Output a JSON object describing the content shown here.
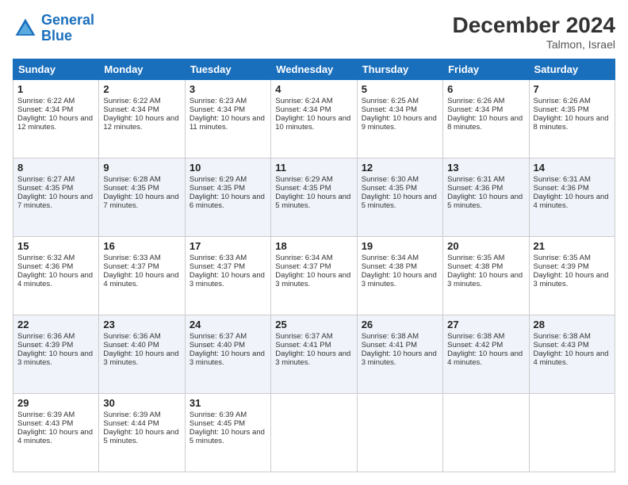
{
  "header": {
    "logo_line1": "General",
    "logo_line2": "Blue",
    "month_title": "December 2024",
    "location": "Talmon, Israel"
  },
  "days_of_week": [
    "Sunday",
    "Monday",
    "Tuesday",
    "Wednesday",
    "Thursday",
    "Friday",
    "Saturday"
  ],
  "weeks": [
    [
      {
        "day": "1",
        "sunrise": "6:22 AM",
        "sunset": "4:34 PM",
        "daylight": "10 hours and 12 minutes."
      },
      {
        "day": "2",
        "sunrise": "6:22 AM",
        "sunset": "4:34 PM",
        "daylight": "10 hours and 12 minutes."
      },
      {
        "day": "3",
        "sunrise": "6:23 AM",
        "sunset": "4:34 PM",
        "daylight": "10 hours and 11 minutes."
      },
      {
        "day": "4",
        "sunrise": "6:24 AM",
        "sunset": "4:34 PM",
        "daylight": "10 hours and 10 minutes."
      },
      {
        "day": "5",
        "sunrise": "6:25 AM",
        "sunset": "4:34 PM",
        "daylight": "10 hours and 9 minutes."
      },
      {
        "day": "6",
        "sunrise": "6:26 AM",
        "sunset": "4:34 PM",
        "daylight": "10 hours and 8 minutes."
      },
      {
        "day": "7",
        "sunrise": "6:26 AM",
        "sunset": "4:35 PM",
        "daylight": "10 hours and 8 minutes."
      }
    ],
    [
      {
        "day": "8",
        "sunrise": "6:27 AM",
        "sunset": "4:35 PM",
        "daylight": "10 hours and 7 minutes."
      },
      {
        "day": "9",
        "sunrise": "6:28 AM",
        "sunset": "4:35 PM",
        "daylight": "10 hours and 7 minutes."
      },
      {
        "day": "10",
        "sunrise": "6:29 AM",
        "sunset": "4:35 PM",
        "daylight": "10 hours and 6 minutes."
      },
      {
        "day": "11",
        "sunrise": "6:29 AM",
        "sunset": "4:35 PM",
        "daylight": "10 hours and 5 minutes."
      },
      {
        "day": "12",
        "sunrise": "6:30 AM",
        "sunset": "4:35 PM",
        "daylight": "10 hours and 5 minutes."
      },
      {
        "day": "13",
        "sunrise": "6:31 AM",
        "sunset": "4:36 PM",
        "daylight": "10 hours and 5 minutes."
      },
      {
        "day": "14",
        "sunrise": "6:31 AM",
        "sunset": "4:36 PM",
        "daylight": "10 hours and 4 minutes."
      }
    ],
    [
      {
        "day": "15",
        "sunrise": "6:32 AM",
        "sunset": "4:36 PM",
        "daylight": "10 hours and 4 minutes."
      },
      {
        "day": "16",
        "sunrise": "6:33 AM",
        "sunset": "4:37 PM",
        "daylight": "10 hours and 4 minutes."
      },
      {
        "day": "17",
        "sunrise": "6:33 AM",
        "sunset": "4:37 PM",
        "daylight": "10 hours and 3 minutes."
      },
      {
        "day": "18",
        "sunrise": "6:34 AM",
        "sunset": "4:37 PM",
        "daylight": "10 hours and 3 minutes."
      },
      {
        "day": "19",
        "sunrise": "6:34 AM",
        "sunset": "4:38 PM",
        "daylight": "10 hours and 3 minutes."
      },
      {
        "day": "20",
        "sunrise": "6:35 AM",
        "sunset": "4:38 PM",
        "daylight": "10 hours and 3 minutes."
      },
      {
        "day": "21",
        "sunrise": "6:35 AM",
        "sunset": "4:39 PM",
        "daylight": "10 hours and 3 minutes."
      }
    ],
    [
      {
        "day": "22",
        "sunrise": "6:36 AM",
        "sunset": "4:39 PM",
        "daylight": "10 hours and 3 minutes."
      },
      {
        "day": "23",
        "sunrise": "6:36 AM",
        "sunset": "4:40 PM",
        "daylight": "10 hours and 3 minutes."
      },
      {
        "day": "24",
        "sunrise": "6:37 AM",
        "sunset": "4:40 PM",
        "daylight": "10 hours and 3 minutes."
      },
      {
        "day": "25",
        "sunrise": "6:37 AM",
        "sunset": "4:41 PM",
        "daylight": "10 hours and 3 minutes."
      },
      {
        "day": "26",
        "sunrise": "6:38 AM",
        "sunset": "4:41 PM",
        "daylight": "10 hours and 3 minutes."
      },
      {
        "day": "27",
        "sunrise": "6:38 AM",
        "sunset": "4:42 PM",
        "daylight": "10 hours and 4 minutes."
      },
      {
        "day": "28",
        "sunrise": "6:38 AM",
        "sunset": "4:43 PM",
        "daylight": "10 hours and 4 minutes."
      }
    ],
    [
      {
        "day": "29",
        "sunrise": "6:39 AM",
        "sunset": "4:43 PM",
        "daylight": "10 hours and 4 minutes."
      },
      {
        "day": "30",
        "sunrise": "6:39 AM",
        "sunset": "4:44 PM",
        "daylight": "10 hours and 5 minutes."
      },
      {
        "day": "31",
        "sunrise": "6:39 AM",
        "sunset": "4:45 PM",
        "daylight": "10 hours and 5 minutes."
      },
      null,
      null,
      null,
      null
    ]
  ]
}
